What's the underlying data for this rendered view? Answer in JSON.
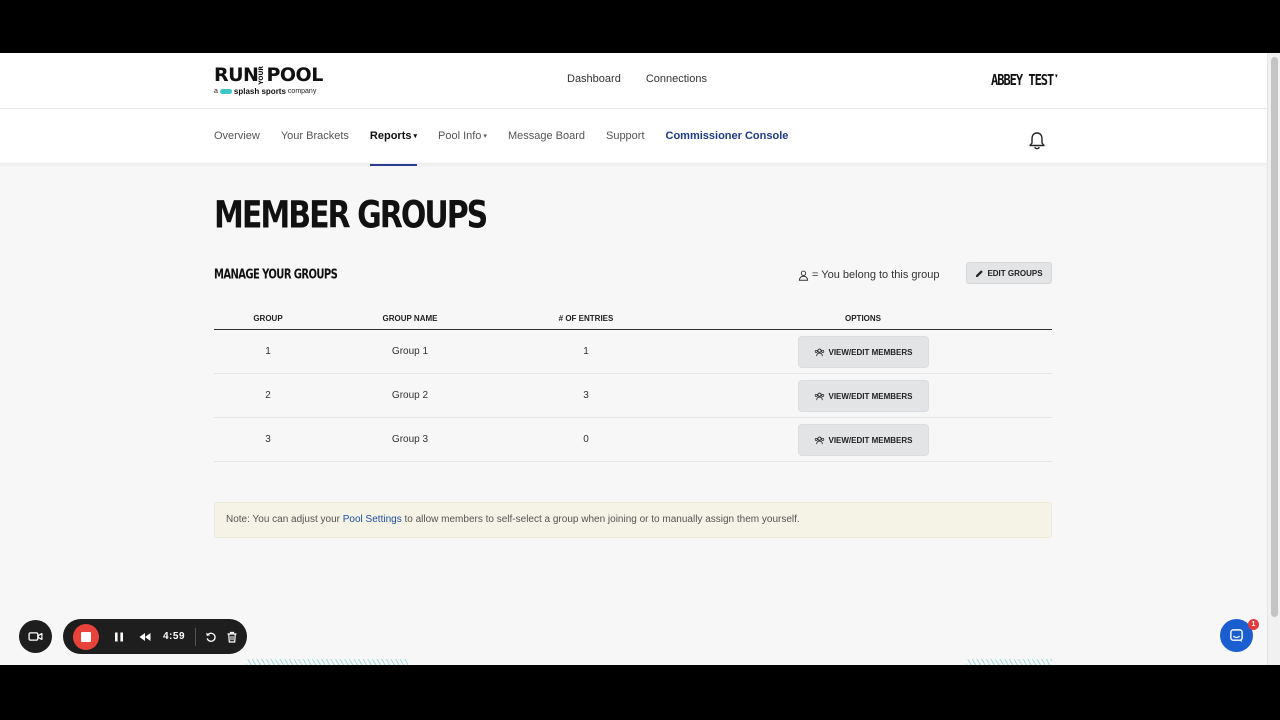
{
  "header": {
    "logo": {
      "run": "RUN",
      "your": "YOUR",
      "pool": "POOL",
      "tagline_prefix": "a",
      "brand": "splash sports",
      "tagline_suffix": "company"
    },
    "links": [
      "Dashboard",
      "Connections"
    ],
    "user_name": "ABBEY TEST"
  },
  "nav": {
    "items": [
      {
        "label": "Overview",
        "has_caret": false
      },
      {
        "label": "Your Brackets",
        "has_caret": false
      },
      {
        "label": "Reports",
        "has_caret": true
      },
      {
        "label": "Pool Info",
        "has_caret": true
      },
      {
        "label": "Message Board",
        "has_caret": false
      },
      {
        "label": "Support",
        "has_caret": false
      },
      {
        "label": "Commissioner Console",
        "has_caret": false
      }
    ],
    "active": "Reports"
  },
  "page": {
    "title": "MEMBER GROUPS",
    "section_title": "MANAGE YOUR GROUPS",
    "legend_text": "= You belong to this group",
    "edit_groups_label": "EDIT GROUPS"
  },
  "table": {
    "headers": [
      "GROUP",
      "GROUP NAME",
      "# OF ENTRIES",
      "OPTIONS"
    ],
    "rows": [
      {
        "group": "1",
        "name": "Group 1",
        "entries": "1",
        "action": "VIEW/EDIT MEMBERS"
      },
      {
        "group": "2",
        "name": "Group 2",
        "entries": "3",
        "action": "VIEW/EDIT MEMBERS"
      },
      {
        "group": "3",
        "name": "Group 3",
        "entries": "0",
        "action": "VIEW/EDIT MEMBERS"
      }
    ]
  },
  "note": {
    "before": "Note: You can adjust your",
    "link": "Pool Settings",
    "after": "to allow members to self-select a group when joining or to manually assign them yourself."
  },
  "recorder": {
    "time": "4:59"
  },
  "chat": {
    "badge_count": "1"
  },
  "colors": {
    "accent_blue": "#1a3a8a",
    "record_red": "#e8433a",
    "chat_blue": "#1a5ed0",
    "note_bg": "#f5f2e6"
  }
}
